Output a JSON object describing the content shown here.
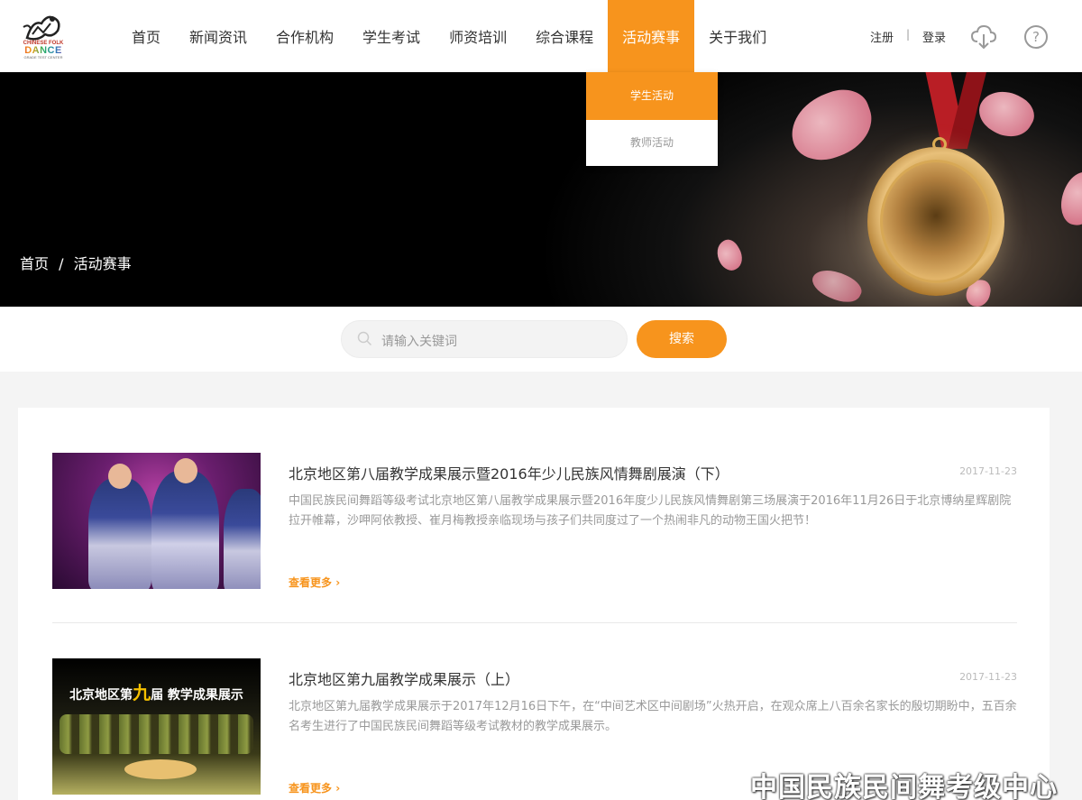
{
  "logo": {
    "line1": "CHINESE FOLK",
    "line2": "DANCE",
    "line3": "GRADE TEST CENTER"
  },
  "nav": {
    "items": [
      "首页",
      "新闻资讯",
      "合作机构",
      "学生考试",
      "师资培训",
      "综合课程",
      "活动赛事",
      "关于我们"
    ],
    "active": "活动赛事"
  },
  "account": {
    "register": "注册",
    "separator": "|",
    "login": "登录"
  },
  "icons": {
    "download": "cloud-download-icon",
    "help": "help-icon"
  },
  "help_glyph": "?",
  "dropdown": {
    "items": [
      "学生活动",
      "教师活动"
    ]
  },
  "breadcrumb": {
    "home": "首页",
    "sep": "/",
    "current": "活动赛事"
  },
  "search": {
    "placeholder": "请输入关键词",
    "button": "搜索"
  },
  "articles": [
    {
      "title": "北京地区第八届教学成果展示暨2016年少儿民族风情舞剧展演（下）",
      "date": "2017-11-23",
      "desc": "中国民族民间舞蹈等级考试北京地区第八届教学成果展示暨2016年度少儿民族风情舞剧第三场展演于2016年11月26日于北京博纳星辉剧院拉开帷幕，沙呷阿依教授、崔月梅教授亲临现场与孩子们共同度过了一个热闹非凡的动物王国火把节！",
      "more": "查看更多"
    },
    {
      "title": "北京地区第九届教学成果展示（上）",
      "date": "2017-11-23",
      "desc": "北京地区第九届教学成果展示于2017年12月16日下午，在“中间艺术区中间剧场”火热开启，在观众席上八百余名家长的殷切期盼中，五百余名考生进行了中国民族民间舞蹈等级考试教材的教学成果展示。",
      "more": "查看更多",
      "thumb_text_a": "北京地区第",
      "thumb_text_b": "九",
      "thumb_text_c": "届 教学成果展示"
    }
  ],
  "watermark": "中国民族民间舞考级中心",
  "colors": {
    "accent": "#f7941d",
    "banner_bg": "#000000"
  }
}
